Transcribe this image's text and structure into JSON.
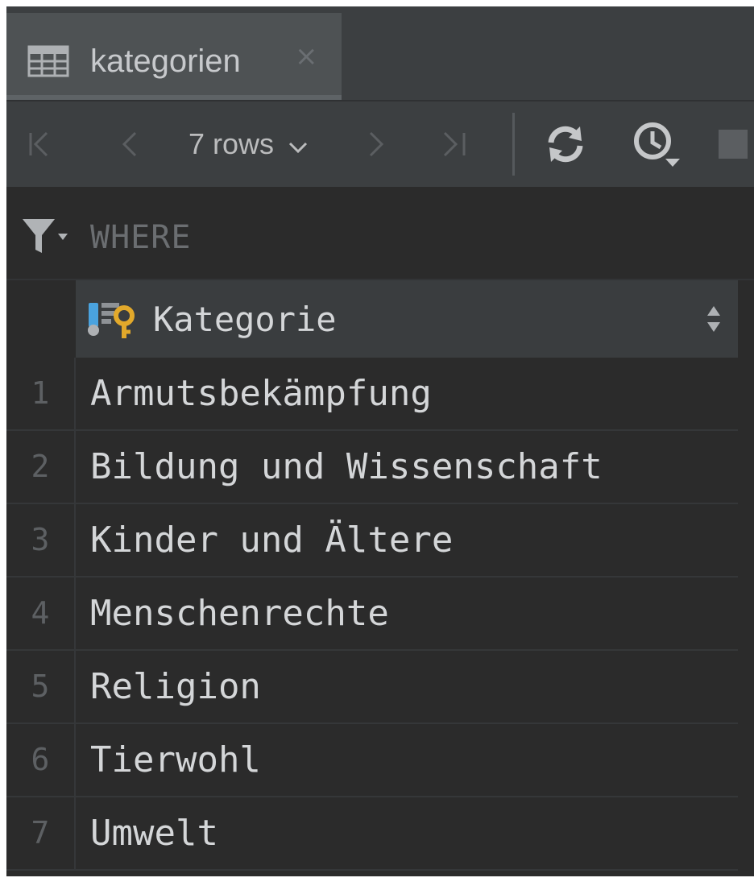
{
  "tab": {
    "title": "kategorien",
    "close": "×",
    "icon": "table-icon"
  },
  "toolbar": {
    "rows_label": "7 rows",
    "buttons": [
      "first-page-icon",
      "prev-page-icon",
      "next-page-icon",
      "last-page-icon",
      "refresh-icon",
      "history-icon",
      "stop-icon"
    ]
  },
  "filter": {
    "label": "WHERE",
    "icon": "filter-icon"
  },
  "table": {
    "column": "Kategorie",
    "column_icon": "primary-key-column-icon",
    "rows": [
      {
        "num": "1",
        "value": "Armutsbekämpfung"
      },
      {
        "num": "2",
        "value": "Bildung und Wissenschaft"
      },
      {
        "num": "3",
        "value": "Kinder und Ältere"
      },
      {
        "num": "4",
        "value": "Menschenrechte"
      },
      {
        "num": "5",
        "value": "Religion"
      },
      {
        "num": "6",
        "value": "Tierwohl"
      },
      {
        "num": "7",
        "value": "Umwelt"
      }
    ]
  },
  "colors": {
    "background": "#2b2b2b",
    "toolbar": "#3c3f41",
    "text": "#d4d6d8",
    "key_icon": "#e2a92b",
    "column_icon_blue": "#4aa3df"
  }
}
